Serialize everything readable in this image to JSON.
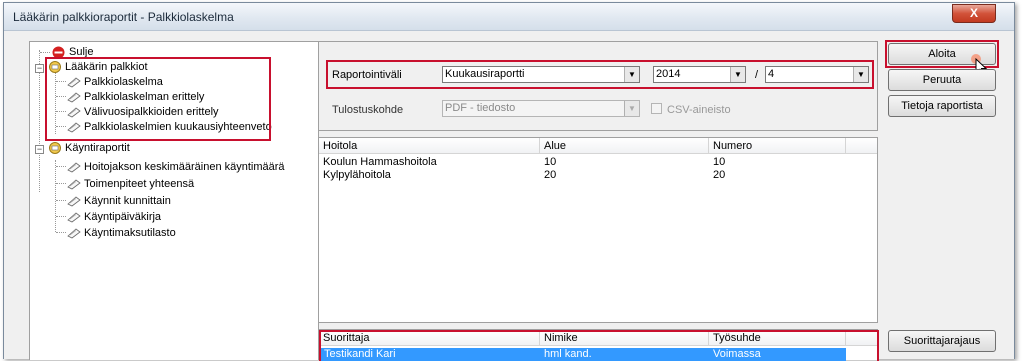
{
  "window": {
    "title": "Lääkärin palkkioraportit  -  Palkkiolaskelma",
    "close_label": "X"
  },
  "tree": {
    "items": [
      {
        "label": "Sulje",
        "icon": "stop-icon"
      },
      {
        "label": "Lääkärin palkkiot",
        "icon": "folder-icon"
      },
      {
        "label": "Palkkiolaskelma",
        "icon": "report-icon"
      },
      {
        "label": "Palkkiolaskelman erittely",
        "icon": "report-icon"
      },
      {
        "label": "Välivuosipalkkioiden erittely",
        "icon": "report-icon"
      },
      {
        "label": "Palkkiolaskelmien kuukausiyhteenveto",
        "icon": "report-icon"
      },
      {
        "label": "Käyntiraportit",
        "icon": "folder-icon"
      },
      {
        "label": "Hoitojakson keskimääräinen käyntimäärä",
        "icon": "report-icon"
      },
      {
        "label": "Toimenpiteet yhteensä",
        "icon": "report-icon"
      },
      {
        "label": "Käynnit kunnittain",
        "icon": "report-icon"
      },
      {
        "label": "Käyntipäiväkirja",
        "icon": "report-icon"
      },
      {
        "label": "Käyntimaksutilasto",
        "icon": "report-icon"
      }
    ]
  },
  "params": {
    "interval_label": "Raportointiväli",
    "interval_value": "Kuukausiraportti",
    "year_value": "2014",
    "separator": "/",
    "month_value": "4",
    "output_label": "Tulostuskohde",
    "output_value": "PDF - tiedosto",
    "csv_label": "CSV-aineisto"
  },
  "clinics": {
    "columns": [
      "Hoitola",
      "Alue",
      "Numero"
    ],
    "rows": [
      [
        "Koulun Hammashoitola",
        "10",
        "10"
      ],
      [
        "Kylpylähoitola",
        "20",
        "20"
      ]
    ]
  },
  "performers": {
    "columns": [
      "Suorittaja",
      "Nimike",
      "Työsuhde"
    ],
    "rows": [
      [
        "Testikandi Kari",
        "hml kand.",
        "Voimassa"
      ]
    ]
  },
  "buttons": {
    "start": "Aloita",
    "cancel": "Peruuta",
    "report_info": "Tietoja raportista",
    "performer_limit": "Suorittajarajaus"
  },
  "colors": {
    "highlight_box": "#c8102e",
    "selection": "#3399ff"
  }
}
